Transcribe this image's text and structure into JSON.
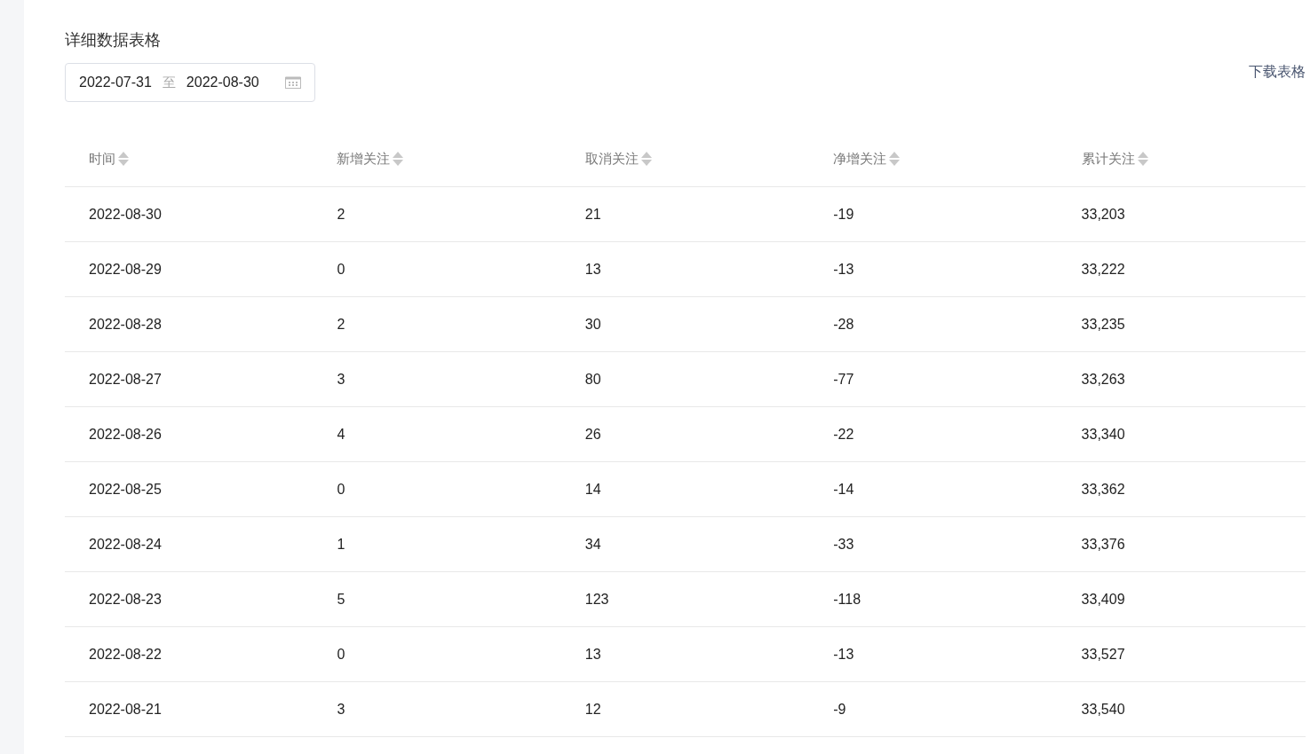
{
  "title": "详细数据表格",
  "date_range": {
    "start": "2022-07-31",
    "separator": "至",
    "end": "2022-08-30"
  },
  "download_link": "下载表格",
  "table": {
    "columns": [
      "时间",
      "新增关注",
      "取消关注",
      "净增关注",
      "累计关注"
    ],
    "rows": [
      [
        "2022-08-30",
        "2",
        "21",
        "-19",
        "33,203"
      ],
      [
        "2022-08-29",
        "0",
        "13",
        "-13",
        "33,222"
      ],
      [
        "2022-08-28",
        "2",
        "30",
        "-28",
        "33,235"
      ],
      [
        "2022-08-27",
        "3",
        "80",
        "-77",
        "33,263"
      ],
      [
        "2022-08-26",
        "4",
        "26",
        "-22",
        "33,340"
      ],
      [
        "2022-08-25",
        "0",
        "14",
        "-14",
        "33,362"
      ],
      [
        "2022-08-24",
        "1",
        "34",
        "-33",
        "33,376"
      ],
      [
        "2022-08-23",
        "5",
        "123",
        "-118",
        "33,409"
      ],
      [
        "2022-08-22",
        "0",
        "13",
        "-13",
        "33,527"
      ],
      [
        "2022-08-21",
        "3",
        "12",
        "-9",
        "33,540"
      ]
    ]
  }
}
